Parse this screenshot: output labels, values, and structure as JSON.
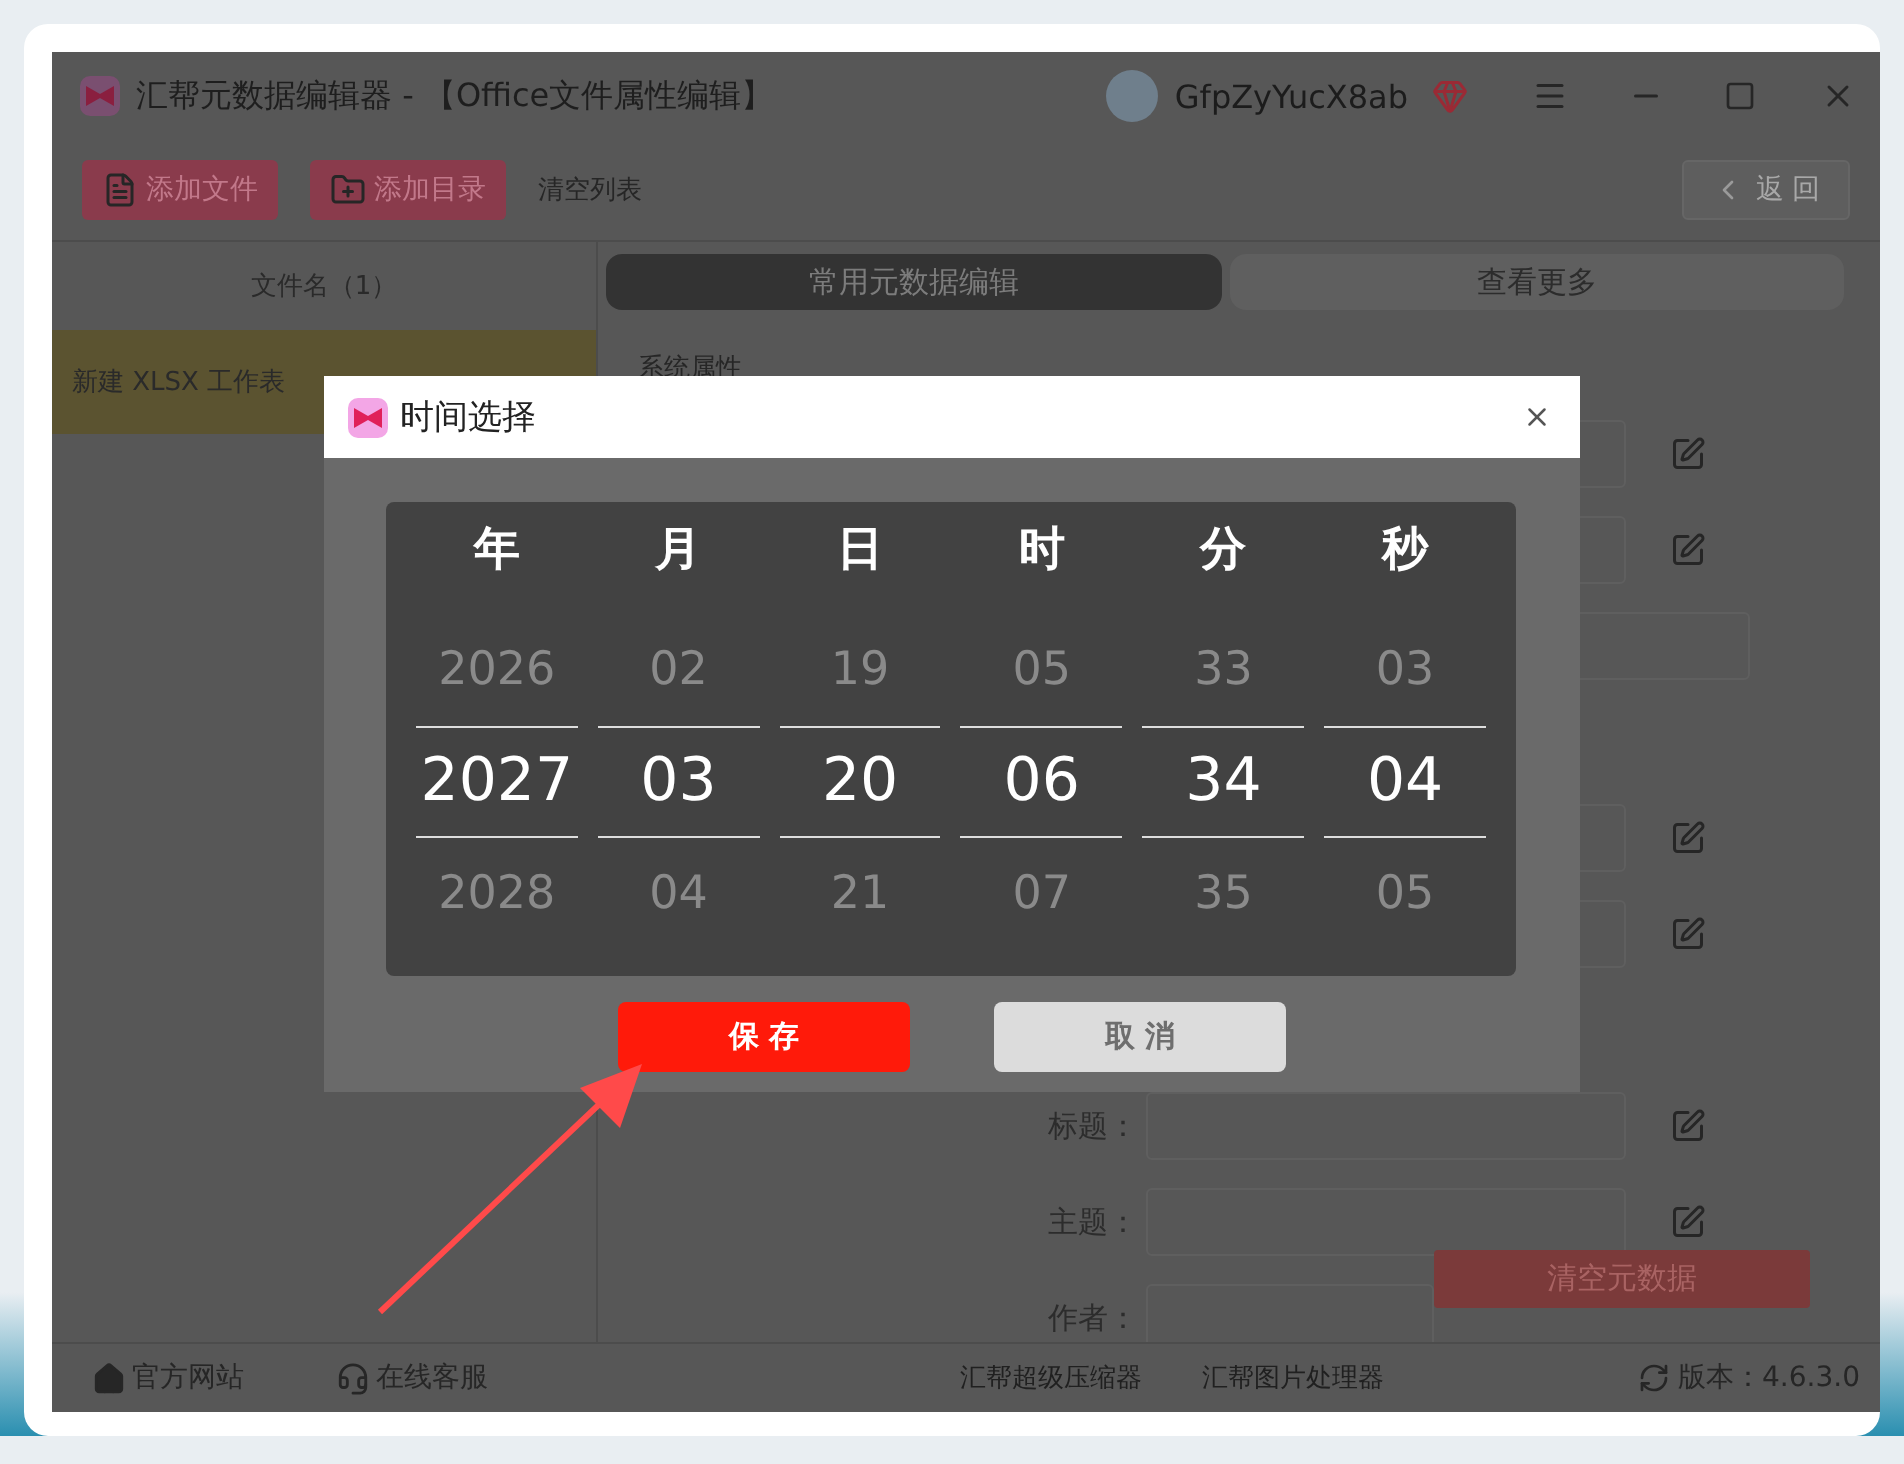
{
  "window": {
    "title": "汇帮元数据编辑器 - 【Office文件属性编辑】",
    "user": "GfpZyYucX8ab"
  },
  "toolbar": {
    "buttons": [
      {
        "label": "添加文件",
        "kind": "file"
      },
      {
        "label": "添加目录",
        "kind": "folder"
      }
    ],
    "clear_list": "清空列表",
    "back": "返 回"
  },
  "file_list": {
    "header": "文件名（1）",
    "files": [
      {
        "name": "新建 XLSX 工作表",
        "selected": true
      }
    ]
  },
  "tabs": [
    {
      "label": "常用元数据编辑",
      "selected": true
    },
    {
      "label": "查看更多",
      "selected": false
    }
  ],
  "form": {
    "section": "系统属性",
    "rows": [
      {
        "kind": "field"
      },
      {
        "kind": "field"
      },
      {
        "kind": "wide"
      },
      {
        "kind": "gap"
      },
      {
        "kind": "field"
      },
      {
        "kind": "field"
      },
      {
        "kind": "gap"
      },
      {
        "kind": "field",
        "label": "标题："
      },
      {
        "kind": "field",
        "label": "主题："
      },
      {
        "kind": "field",
        "label": "作者："
      }
    ],
    "clear_button": "清空元数据"
  },
  "footer": {
    "links": [
      {
        "label": "官方网站",
        "kind": "home"
      },
      {
        "label": "在线客服",
        "kind": "service"
      }
    ],
    "apps": [
      "汇帮超级压缩器",
      "汇帮图片处理器"
    ],
    "version": "版本：4.6.3.0"
  },
  "dialog": {
    "title": "时间选择",
    "columns": [
      {
        "header": "年",
        "prev": "2026",
        "current": "2027",
        "next": "2028"
      },
      {
        "header": "月",
        "prev": "02",
        "current": "03",
        "next": "04"
      },
      {
        "header": "日",
        "prev": "19",
        "current": "20",
        "next": "21"
      },
      {
        "header": "时",
        "prev": "05",
        "current": "06",
        "next": "07"
      },
      {
        "header": "分",
        "prev": "33",
        "current": "34",
        "next": "35"
      },
      {
        "header": "秒",
        "prev": "03",
        "current": "04",
        "next": "05"
      }
    ],
    "save": "保 存",
    "cancel": "取 消"
  }
}
